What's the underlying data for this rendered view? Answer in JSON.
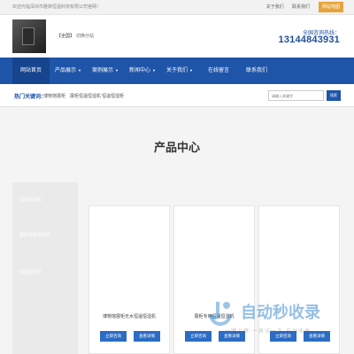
{
  "topbar": {
    "welcome": "欢迎光临深圳市雅菲恒温科技有限公司官网！",
    "links": [
      "关于我们",
      "联系我们"
    ],
    "sitemap": "网站地图"
  },
  "header": {
    "switch_city": "【全国】",
    "switch_link": "切换分站",
    "hotline_label": "全国咨询热线：",
    "hotline_number": "13144843931"
  },
  "nav": {
    "items": [
      {
        "label": "网站首页",
        "dropdown": false
      },
      {
        "label": "产品展示",
        "dropdown": true
      },
      {
        "label": "案例展示",
        "dropdown": true
      },
      {
        "label": "新闻中心",
        "dropdown": true
      },
      {
        "label": "关于我们",
        "dropdown": true
      },
      {
        "label": "在线留言",
        "dropdown": false
      },
      {
        "label": "联系我们",
        "dropdown": false
      }
    ],
    "caret": "▼"
  },
  "keywords": {
    "label": "热门关键词：",
    "items": [
      "博物馆展柜",
      "展柜恒温恒湿机",
      "恒温恒湿柜"
    ],
    "search_placeholder": "请输入关键字",
    "search_button": "搜索"
  },
  "main": {
    "title": "产品中心",
    "sidebar": [
      "恒温恒湿机",
      "展柜恒温恒湿机",
      "恒温恒湿柜"
    ],
    "products": [
      {
        "name": "博物馆展柜无水恒温恒湿机",
        "btn_consult": "立即咨询",
        "btn_detail": "查看详情"
      },
      {
        "name": "展柜专用恒温恒湿机",
        "btn_consult": "立即咨询",
        "btn_detail": "查看详情"
      },
      {
        "name": "",
        "btn_consult": "立即咨询",
        "btn_detail": "查看详情"
      }
    ]
  },
  "watermark": {
    "title": "自动秒收录",
    "slogan": "一键上榜·一来访一次·自动收录"
  },
  "colors": {
    "brand_blue": "#1f55a9",
    "sitemap_orange": "#e8a33b",
    "button_blue": "#2b6cc4"
  }
}
